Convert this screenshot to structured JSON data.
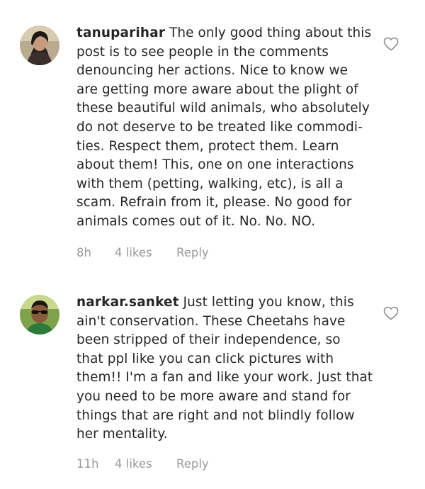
{
  "comments": [
    {
      "username": "tanuparihar",
      "text_lines": [
        "The only good thing about this",
        "post is to see people in the comments",
        "denouncing her actions. Nice to know we",
        "are getting more aware about the plight of",
        "these beautiful wild animals, who absolutely",
        "do not deserve to be treated like commodi-",
        "ties. Respect them, protect them. Learn",
        "about them! This, one on one interactions",
        "with them (petting, walking, etc), is all a",
        "scam. Refrain from it, please. No good for",
        "animals comes out of it. No. No. NO."
      ],
      "time": "8h",
      "likes": "4 likes",
      "reply": "Reply",
      "avatar_icon": "user-avatar-photo",
      "like_icon": "heart-outline-icon"
    },
    {
      "username": "narkar.sanket",
      "text_lines": [
        "Just letting you know, this",
        "ain't conservation. These Cheetahs have",
        "been stripped of their independence, so",
        "that ppl like you can click pictures with",
        "them!! I'm a fan and like your work. Just that",
        "you need to be more aware and stand for",
        "things that are right and not blindly follow",
        "her mentality."
      ],
      "time": "11h",
      "likes": "4 likes",
      "reply": "Reply",
      "avatar_icon": "user-avatar-photo",
      "like_icon": "heart-outline-icon"
    }
  ],
  "colors": {
    "text": "#262626",
    "meta": "#9a9a9a",
    "background": "#ffffff"
  }
}
